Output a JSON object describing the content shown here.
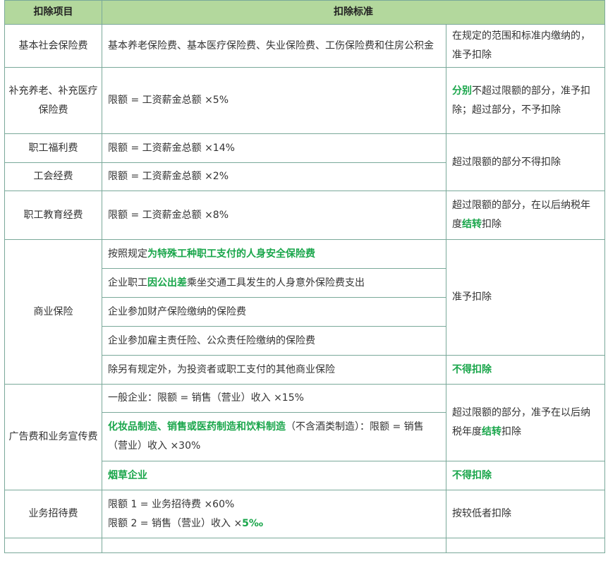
{
  "colors": {
    "header_bg": "#b3d89d",
    "border": "#7aa99a",
    "highlight_text": "#1aa64b",
    "body_text": "#333333"
  },
  "table": {
    "headers": [
      "扣除项目",
      "扣除标准"
    ],
    "rows": {
      "basic_social_insurance": {
        "item": "基本社会保险费",
        "standard": [
          {
            "t": "基本养老保险费、基本医疗保险费、失业保险费、工伤保险费和住房公积金"
          }
        ],
        "result": [
          {
            "t": "在规定的范围和标准内缴纳的，准予扣除"
          }
        ]
      },
      "supplementary_insurance": {
        "item": "补充养老、补充医疗保险费",
        "standard": [
          {
            "t": "限额 = 工资薪金总额 ×5%"
          }
        ],
        "result": [
          {
            "t": "分别",
            "hl": true
          },
          {
            "t": "不超过限额的部分，准予扣除；超过部分，不予扣除"
          }
        ]
      },
      "employee_welfare": {
        "item": "职工福利费",
        "standard": [
          {
            "t": "限额 = 工资薪金总额 ×14%"
          }
        ],
        "result": [
          {
            "t": "超过限额的部分不得扣除"
          }
        ]
      },
      "union_funds": {
        "item": "工会经费",
        "standard": [
          {
            "t": "限额 = 工资薪金总额 ×2%"
          }
        ]
      },
      "employee_education": {
        "item": "职工教育经费",
        "standard": [
          {
            "t": "限额 = 工资薪金总额 ×8%"
          }
        ],
        "result": [
          {
            "t": "超过限额的部分，在以后纳税年度"
          },
          {
            "t": "结转",
            "hl": true
          },
          {
            "t": "扣除"
          }
        ]
      },
      "commercial_insurance": {
        "item": "商业保险",
        "standards": [
          [
            {
              "t": "按照规定"
            },
            {
              "t": "为特殊工种职工支付的人身安全保险费",
              "hl": true
            }
          ],
          [
            {
              "t": "企业职工"
            },
            {
              "t": "因公出差",
              "hl": true
            },
            {
              "t": "乘坐交通工具发生的人身意外保险费支出"
            }
          ],
          [
            {
              "t": "企业参加财产保险缴纳的保险费"
            }
          ],
          [
            {
              "t": "企业参加雇主责任险、公众责任险缴纳的保险费"
            }
          ],
          [
            {
              "t": "除另有规定外，为投资者或职工支付的其他商业保险"
            }
          ]
        ],
        "result_allowed": [
          {
            "t": "准予扣除"
          }
        ],
        "result_denied": [
          {
            "t": "不得扣除",
            "hl": true
          }
        ]
      },
      "advertising": {
        "item": "广告费和业务宣传费",
        "standards": [
          [
            {
              "t": "一般企业：限额 = 销售（营业）收入 ×15%"
            }
          ],
          [
            {
              "t": "化妆品制造、销售或医药制造和饮料制造",
              "hl": true
            },
            {
              "t": "（不含酒类制造）：限额 = 销售（营业）收入 ×30%"
            }
          ],
          [
            {
              "t": "烟草企业",
              "hl": true
            }
          ]
        ],
        "result_carry": [
          {
            "t": "超过限额的部分，准予在以后纳税年度"
          },
          {
            "t": "结转",
            "hl": true
          },
          {
            "t": "扣除"
          }
        ],
        "result_denied": [
          {
            "t": "不得扣除",
            "hl": true
          }
        ]
      },
      "entertainment": {
        "item": "业务招待费",
        "standard_lines": [
          [
            {
              "t": "限额 1 = 业务招待费 ×60%"
            }
          ],
          [
            {
              "t": "限额 2 = 销售（营业）收入 ×"
            },
            {
              "t": "5‰",
              "hl": true
            }
          ]
        ],
        "result": [
          {
            "t": "按较低者扣除"
          }
        ]
      }
    }
  }
}
